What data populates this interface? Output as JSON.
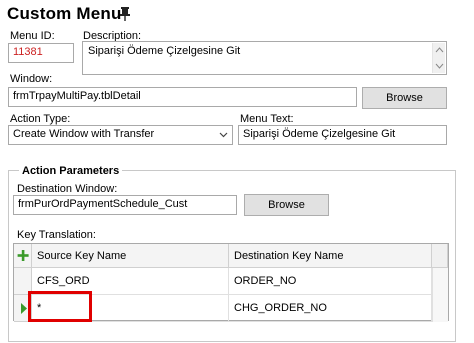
{
  "title": "Custom Menu",
  "menu_id": {
    "label": "Menu ID:",
    "value": "11381"
  },
  "description": {
    "label": "Description:",
    "value": "Siparişi Ödeme Çizelgesine Git"
  },
  "window": {
    "label": "Window:",
    "value": "frmTrpayMultiPay.tblDetail",
    "browse_label": "Browse"
  },
  "action_type": {
    "label": "Action Type:",
    "value": "Create Window with Transfer"
  },
  "menu_text": {
    "label": "Menu Text:",
    "value": "Siparişi Ödeme Çizelgesine Git"
  },
  "action_parameters": {
    "title": "Action Parameters",
    "destination_window": {
      "label": "Destination Window:",
      "value": "frmPurOrdPaymentSchedule_Cust",
      "browse_label": "Browse"
    },
    "key_translation": {
      "label": "Key Translation:",
      "columns": [
        "Source Key Name",
        "Destination Key Name"
      ],
      "rows": [
        {
          "source": "CFS_ORD",
          "destination": "ORDER_NO"
        },
        {
          "source": "*",
          "destination": "CHG_ORDER_NO"
        }
      ]
    }
  },
  "colors": {
    "menu_id_text": "#cc2222",
    "highlight_box": "#e00000",
    "add_icon": "#3a9a2a",
    "selected_row_marker": "#3a9a2a"
  },
  "icons": {
    "pin": "pin-icon",
    "dropdown": "chevron-down-icon",
    "add": "plus-icon",
    "row_marker": "triangle-right-icon"
  }
}
